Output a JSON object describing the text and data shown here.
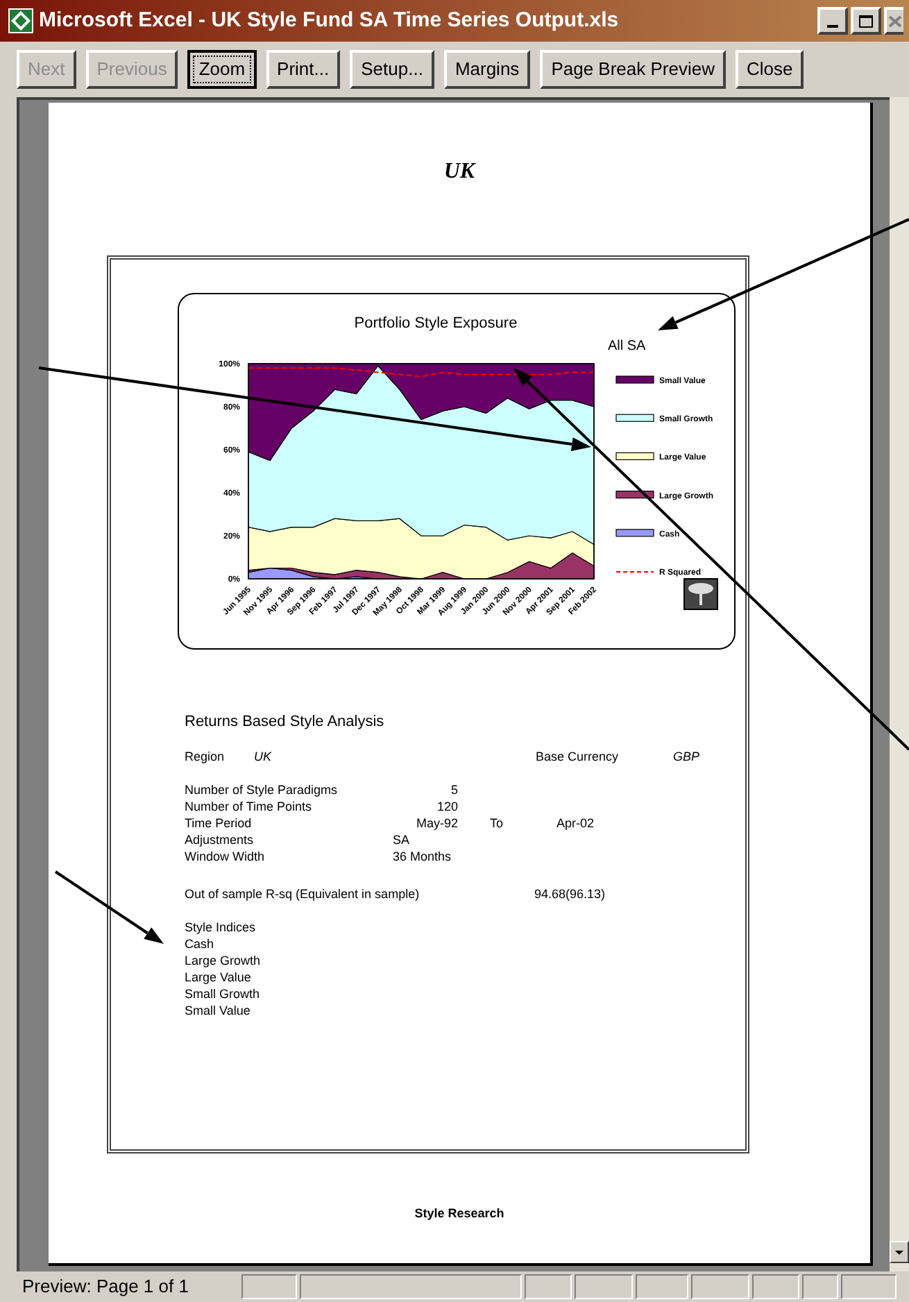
{
  "window": {
    "title": "Microsoft Excel - UK Style Fund SA Time Series Output.xls"
  },
  "toolbar": [
    {
      "label": "Next",
      "disabled": true,
      "focused": false
    },
    {
      "label": "Previous",
      "disabled": true,
      "focused": false
    },
    {
      "label": "Zoom",
      "disabled": false,
      "focused": true
    },
    {
      "label": "Print...",
      "disabled": false,
      "focused": false
    },
    {
      "label": "Setup...",
      "disabled": false,
      "focused": false
    },
    {
      "label": "Margins",
      "disabled": false,
      "focused": false
    },
    {
      "label": "Page Break Preview",
      "disabled": false,
      "focused": false
    },
    {
      "label": "Close",
      "disabled": false,
      "focused": false
    }
  ],
  "page": {
    "heading": "UK",
    "chart": {
      "title": "Portfolio Style Exposure",
      "subtitle": "All SA",
      "chart_data": {
        "type": "area",
        "stacked": true,
        "legend": "right",
        "ylim": [
          0,
          100
        ],
        "yticks": [
          {
            "value": 0,
            "label": "0%"
          },
          {
            "value": 20,
            "label": "20%"
          },
          {
            "value": 40,
            "label": "40%"
          },
          {
            "value": 60,
            "label": "60%"
          },
          {
            "value": 80,
            "label": "80%"
          },
          {
            "value": 100,
            "label": "100%"
          }
        ],
        "categories": [
          "Jun 1995",
          "Nov 1995",
          "Apr 1996",
          "Sep 1996",
          "Feb 1997",
          "Jul 1997",
          "Dec 1997",
          "May 1998",
          "Oct 1998",
          "Mar 1999",
          "Aug 1999",
          "Jan 2000",
          "Jun 2000",
          "Nov 2000",
          "Apr 2001",
          "Sep 2001",
          "Feb 2002"
        ],
        "series": [
          {
            "name": "Small Value",
            "type": "area",
            "color": "#660066",
            "values": [
              41,
              45,
              30,
              22,
              12,
              14,
              1,
              12,
              26,
              22,
              20,
              23,
              16,
              21,
              17,
              17,
              20
            ]
          },
          {
            "name": "Small Growth",
            "type": "area",
            "color": "#ccffff",
            "values": [
              35,
              33,
              46,
              54,
              60,
              59,
              72,
              60,
              54,
              58,
              55,
              53,
              66,
              59,
              64,
              61,
              64
            ]
          },
          {
            "name": "Large Value",
            "type": "area",
            "color": "#ffffcc",
            "values": [
              20,
              17,
              19,
              21,
              26,
              23,
              24,
              27,
              20,
              17,
              25,
              24,
              15,
              12,
              14,
              10,
              10
            ]
          },
          {
            "name": "Large Growth",
            "type": "area",
            "color": "#993366",
            "values": [
              1,
              0,
              1,
              2,
              2,
              3,
              3,
              1,
              0,
              3,
              0,
              0,
              3,
              8,
              5,
              12,
              6
            ]
          },
          {
            "name": "Cash",
            "type": "area",
            "color": "#9999ff",
            "values": [
              3,
              5,
              4,
              1,
              0,
              1,
              0,
              0,
              0,
              0,
              0,
              0,
              0,
              0,
              0,
              0,
              0
            ]
          },
          {
            "name": "R Squared",
            "type": "line",
            "line_style": "dashed",
            "color": "#ff0000",
            "values": [
              98,
              98,
              98,
              98,
              98,
              97,
              96,
              95,
              94,
              96,
              95,
              95,
              95,
              95,
              95,
              96,
              96
            ]
          }
        ]
      }
    },
    "report": {
      "heading": "Returns Based Style Analysis",
      "region_label": "Region",
      "region_value": "UK",
      "currency_label": "Base Currency",
      "currency_value": "GBP",
      "params": [
        {
          "label": "Number of Style Paradigms",
          "kind": "number",
          "value": "5"
        },
        {
          "label": "Number of Time Points",
          "kind": "number",
          "value": "120"
        },
        {
          "label": "Time Period",
          "kind": "range",
          "value": "May-92",
          "to_label": "To",
          "end_value": "Apr-02"
        },
        {
          "label": "Adjustments",
          "kind": "text",
          "value": "SA"
        },
        {
          "label": "Window Width",
          "kind": "text",
          "value": "36 Months"
        }
      ],
      "rsq_label": "Out of sample R-sq (Equivalent in sample)",
      "rsq_value": "94.68(96.13)",
      "indices_label": "Style Indices",
      "indices": [
        "Cash",
        "Large Growth",
        "Large Value",
        "Small Growth",
        "Small Value"
      ]
    },
    "footer": "Style Research"
  },
  "status_bar": {
    "text": "Preview: Page 1 of 1"
  }
}
